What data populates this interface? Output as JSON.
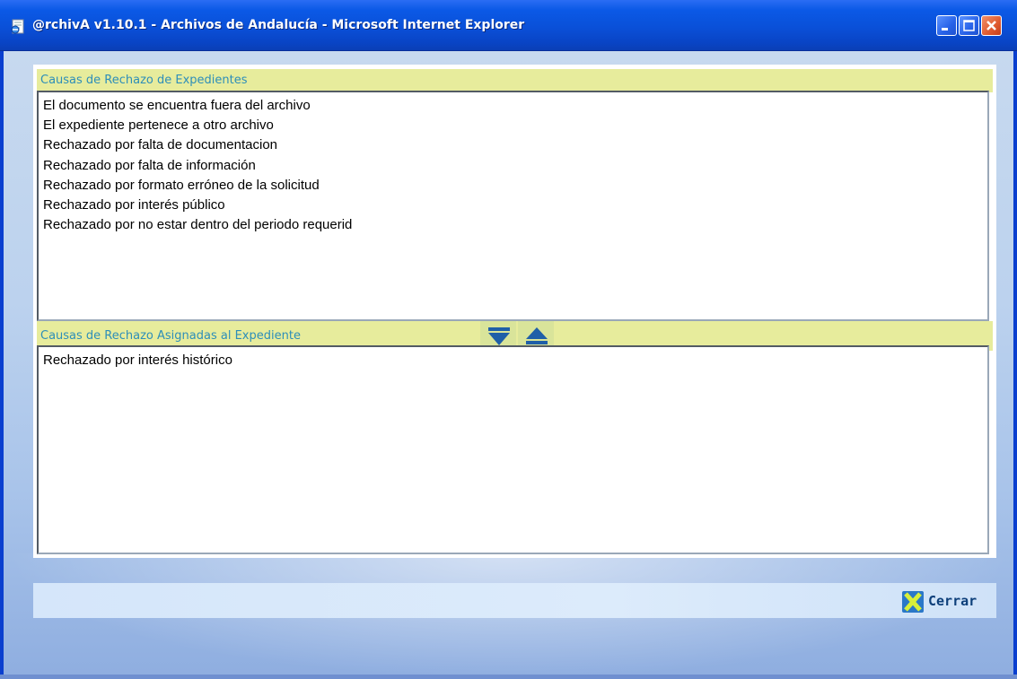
{
  "window": {
    "title": "@rchivA v1.10.1 - Archivos de Andalucía - Microsoft Internet Explorer"
  },
  "available_panel": {
    "header": "Causas de Rechazo de Expedientes",
    "items": [
      "El documento se encuentra fuera del archivo",
      "El expediente pertenece a otro archivo",
      "Rechazado por falta de documentacion",
      "Rechazado por falta de información",
      "Rechazado por formato erróneo de la solicitud",
      "Rechazado por interés público",
      "Rechazado por no estar dentro del periodo requerid"
    ]
  },
  "assigned_panel": {
    "header": "Causas de Rechazo Asignadas al Expediente",
    "items": [
      "Rechazado por interés histórico"
    ]
  },
  "footer": {
    "close_label": "Cerrar"
  },
  "colors": {
    "header_bg": "#e7ec9c",
    "header_text": "#2d8eb9",
    "titlebar": "#0a50d8"
  }
}
